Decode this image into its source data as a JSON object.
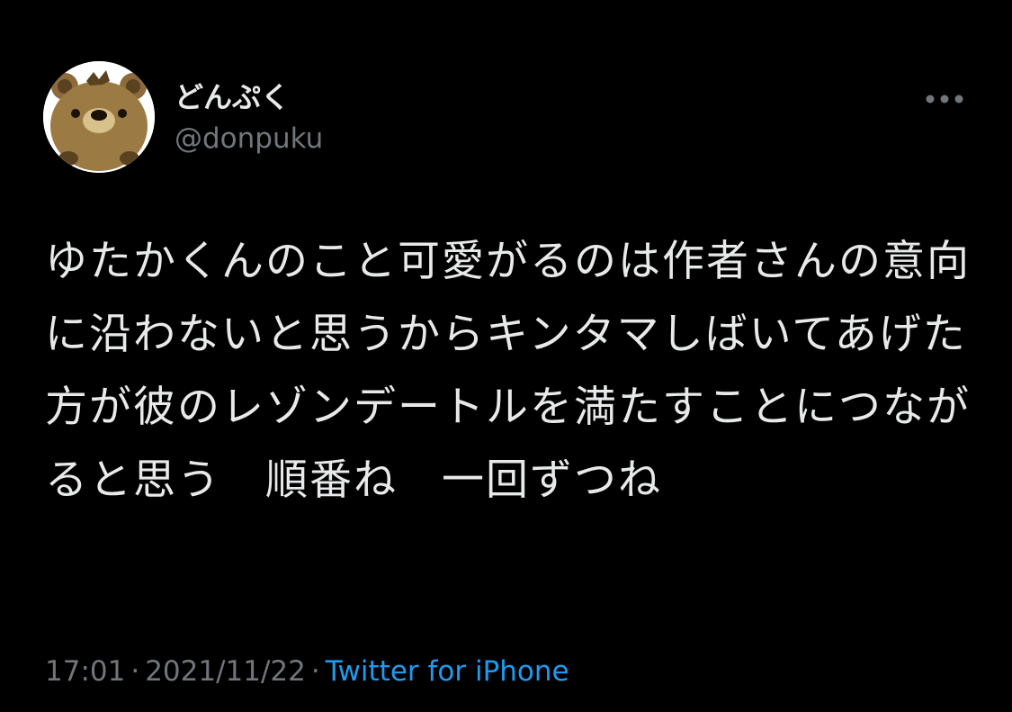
{
  "tweet": {
    "author": {
      "display_name": "どんぷく",
      "handle": "@donpuku",
      "avatar_icon": "bear-avatar-icon"
    },
    "more_icon": "more-dots-icon",
    "text": "ゆたかくんのこと可愛がるのは作者さんの意向に沿わないと思うからキンタマしばいてあげた方が彼のレゾンデートルを満たすことにつながると思う　順番ね　一回ずつね",
    "time": "17:01",
    "separator": "·",
    "date": "2021/11/22",
    "source": "Twitter for iPhone"
  },
  "colors": {
    "background": "#000000",
    "primary_text": "#e7e9ea",
    "secondary_text": "#71767b",
    "link": "#1d9bf0"
  }
}
